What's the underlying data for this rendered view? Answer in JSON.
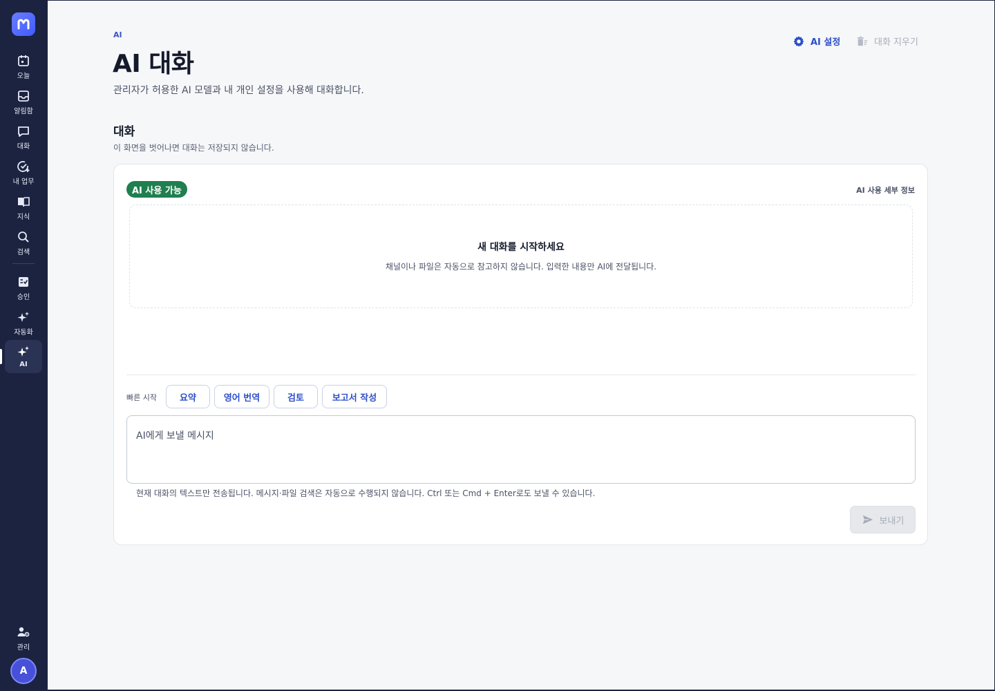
{
  "sidebar": {
    "items": [
      {
        "label": "오늘",
        "icon": "calendar-icon"
      },
      {
        "label": "알림함",
        "icon": "inbox-icon"
      },
      {
        "label": "대화",
        "icon": "chat-icon"
      },
      {
        "label": "내 업무",
        "icon": "task-check-icon"
      },
      {
        "label": "지식",
        "icon": "book-icon"
      },
      {
        "label": "검색",
        "icon": "search-icon"
      },
      {
        "label": "승인",
        "icon": "approval-icon"
      },
      {
        "label": "자동화",
        "icon": "sparkle-icon"
      },
      {
        "label": "AI",
        "icon": "ai-sparkle-icon",
        "active": true
      }
    ],
    "admin_label": "관리",
    "avatar_initial": "A"
  },
  "header": {
    "eyebrow": "AI",
    "title": "AI 대화",
    "description": "관리자가 허용한 AI 모델과 내 개인 설정을 사용해 대화합니다.",
    "settings_label": "AI 설정",
    "clear_label": "대화 지우기"
  },
  "conversation": {
    "title": "대화",
    "description": "이 화면을 벗어나면 대화는 저장되지 않습니다.",
    "status_badge": "AI 사용 가능",
    "details_link": "AI 사용 세부 정보",
    "empty_title": "새 대화를 시작하세요",
    "empty_desc": "채널이나 파일은 자동으로 참고하지 않습니다. 입력한 내용만 AI에 전달됩니다.",
    "quick_start_label": "빠른 시작",
    "quick_actions": [
      "요약",
      "영어 번역",
      "검토",
      "보고서 작성"
    ],
    "input_placeholder": "AI에게 보낼 메시지",
    "hint": "현재 대화의 텍스트만 전송됩니다. 메시지·파일 검색은 자동으로 수행되지 않습니다. Ctrl 또는 Cmd + Enter로도 보낼 수 있습니다.",
    "send_label": "보내기"
  },
  "colors": {
    "sidebar_bg": "#1b2340",
    "accent": "#2d4fc9",
    "status_green": "#1f7f4f"
  }
}
